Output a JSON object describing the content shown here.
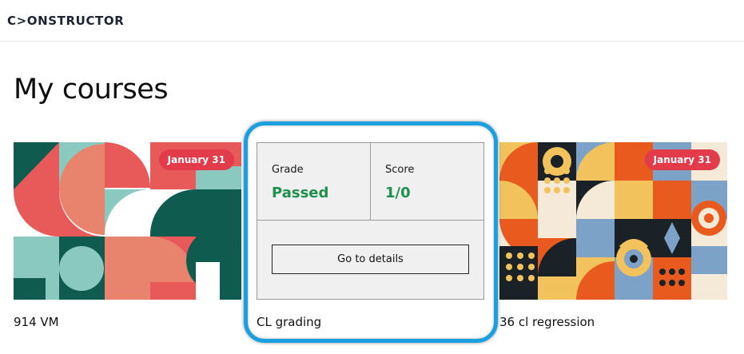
{
  "header": {
    "logo_text": "C>ONSTRUCTOR"
  },
  "page": {
    "title": "My courses"
  },
  "courses": [
    {
      "title": "914 VM",
      "badge": "January 31"
    },
    {
      "title": "CL grading",
      "grade_label": "Grade",
      "grade_value": "Passed",
      "score_label": "Score",
      "score_value": "1/0",
      "details_label": "Go to details"
    },
    {
      "title": "36 cl regression",
      "badge": "January 31"
    }
  ],
  "colors": {
    "accent_green": "#1e8f4d",
    "badge_red": "#e23b4a",
    "highlight_blue": "#1a9fe0"
  }
}
